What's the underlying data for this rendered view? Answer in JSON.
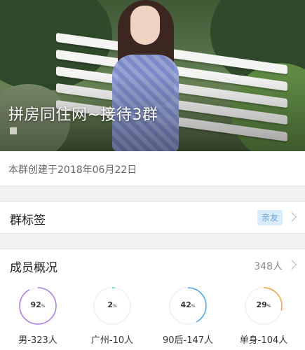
{
  "header": {
    "group_name": "拼房同住网~接待3群"
  },
  "created": {
    "text": "本群创建于2018年06月22日"
  },
  "tags_row": {
    "label": "群标签",
    "tag": "亲友"
  },
  "members_row": {
    "label": "成员概况",
    "count": "348人"
  },
  "stats": [
    {
      "percent": "92",
      "unit": "%",
      "caption": "男-323人",
      "value": 0.92,
      "color": "#a77be0"
    },
    {
      "percent": "2",
      "unit": "%",
      "caption": "广州-10人",
      "value": 0.02,
      "color": "#4fc9d6"
    },
    {
      "percent": "42",
      "unit": "%",
      "caption": "90后-147人",
      "value": 0.42,
      "color": "#4aa3ea"
    },
    {
      "percent": "29",
      "unit": "%",
      "caption": "单身-104人",
      "value": 0.29,
      "color": "#f0a44a"
    }
  ]
}
